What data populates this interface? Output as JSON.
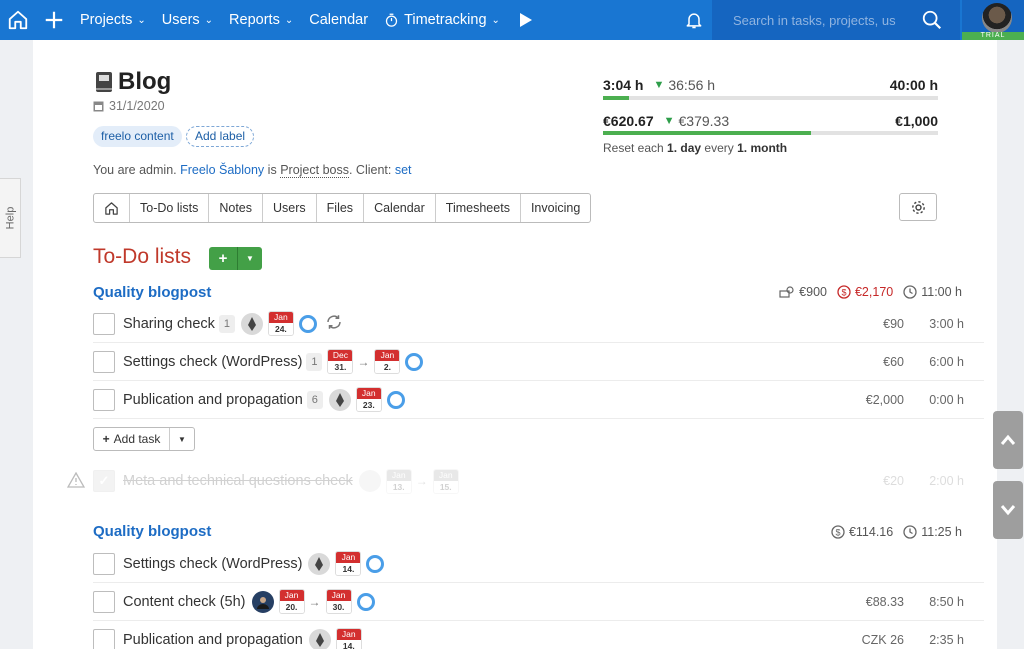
{
  "nav": {
    "items": [
      {
        "label": "Projects",
        "chevron": true
      },
      {
        "label": "Users",
        "chevron": true
      },
      {
        "label": "Reports",
        "chevron": true
      },
      {
        "label": "Calendar",
        "chevron": false
      },
      {
        "label": "Timetracking",
        "chevron": true
      }
    ],
    "search_placeholder": "Search in tasks, projects, us",
    "trial_label": "TRIAL",
    "colors": {
      "bar": "#1976d2",
      "accent_green": "#43a047",
      "date_red": "#d32f2f"
    }
  },
  "help_label": "Help",
  "project": {
    "title": "Blog",
    "date": "31/1/2020",
    "labels": [
      "freelo content"
    ],
    "add_label": "Add label",
    "admin": {
      "prefix": "You are admin.",
      "user": "Freelo Šablony",
      "is": "is",
      "role": "Project boss",
      "client_prefix": ". Client:",
      "client_link": "set"
    },
    "tabs": [
      "To-Do lists",
      "Notes",
      "Users",
      "Files",
      "Calendar",
      "Timesheets",
      "Invoicing"
    ]
  },
  "stats": {
    "time": {
      "main": "3:04 h",
      "sub": "36:56 h",
      "limit": "40:00 h",
      "progress": 0.077
    },
    "money": {
      "main": "€620.67",
      "sub": "€379.33",
      "limit": "€1,000",
      "progress": 0.62
    },
    "reset": {
      "prefix": "Reset each",
      "period1": "1. day",
      "mid": "every",
      "period2": "1. month"
    }
  },
  "todo_header": "To-Do lists",
  "lists": [
    {
      "title": "Quality blogpost",
      "stats": {
        "budget": "€900",
        "spent": "€2,170",
        "time": "11:00 h"
      },
      "tasks": [
        {
          "name": "Sharing check",
          "count": "1",
          "dates": [
            {
              "m": "Jan",
              "d": "24."
            }
          ],
          "price": "€90",
          "time": "3:00 h"
        },
        {
          "name": "Settings check (WordPress)",
          "count": "1",
          "dates": [
            {
              "m": "Dec",
              "d": "31."
            },
            {
              "m": "Jan",
              "d": "2."
            }
          ],
          "price": "€60",
          "time": "6:00 h"
        },
        {
          "name": "Publication and propagation",
          "count": "6",
          "dates": [
            {
              "m": "Jan",
              "d": "23."
            }
          ],
          "price": "€2,000",
          "time": "0:00 h"
        }
      ],
      "add_task": "Add task",
      "done_task": {
        "name": "Meta and technical questions check",
        "dates": [
          {
            "m": "Jan",
            "d": "13."
          },
          {
            "m": "Jan",
            "d": "15."
          }
        ],
        "price": "€20",
        "time": "2:00 h"
      }
    },
    {
      "title": "Quality blogpost",
      "stats": {
        "spent": "€114.16",
        "time": "11:25 h"
      },
      "tasks": [
        {
          "name": "Settings check (WordPress)",
          "dates": [
            {
              "m": "Jan",
              "d": "14."
            }
          ]
        },
        {
          "name": "Content check (5h)",
          "dates": [
            {
              "m": "Jan",
              "d": "20."
            },
            {
              "m": "Jan",
              "d": "30."
            }
          ],
          "price": "€88.33",
          "time": "8:50 h"
        },
        {
          "name": "Publication and propagation",
          "dates": [
            {
              "m": "Jan",
              "d": "14."
            }
          ],
          "price": "CZK 26",
          "time": "2:35 h"
        }
      ]
    }
  ]
}
